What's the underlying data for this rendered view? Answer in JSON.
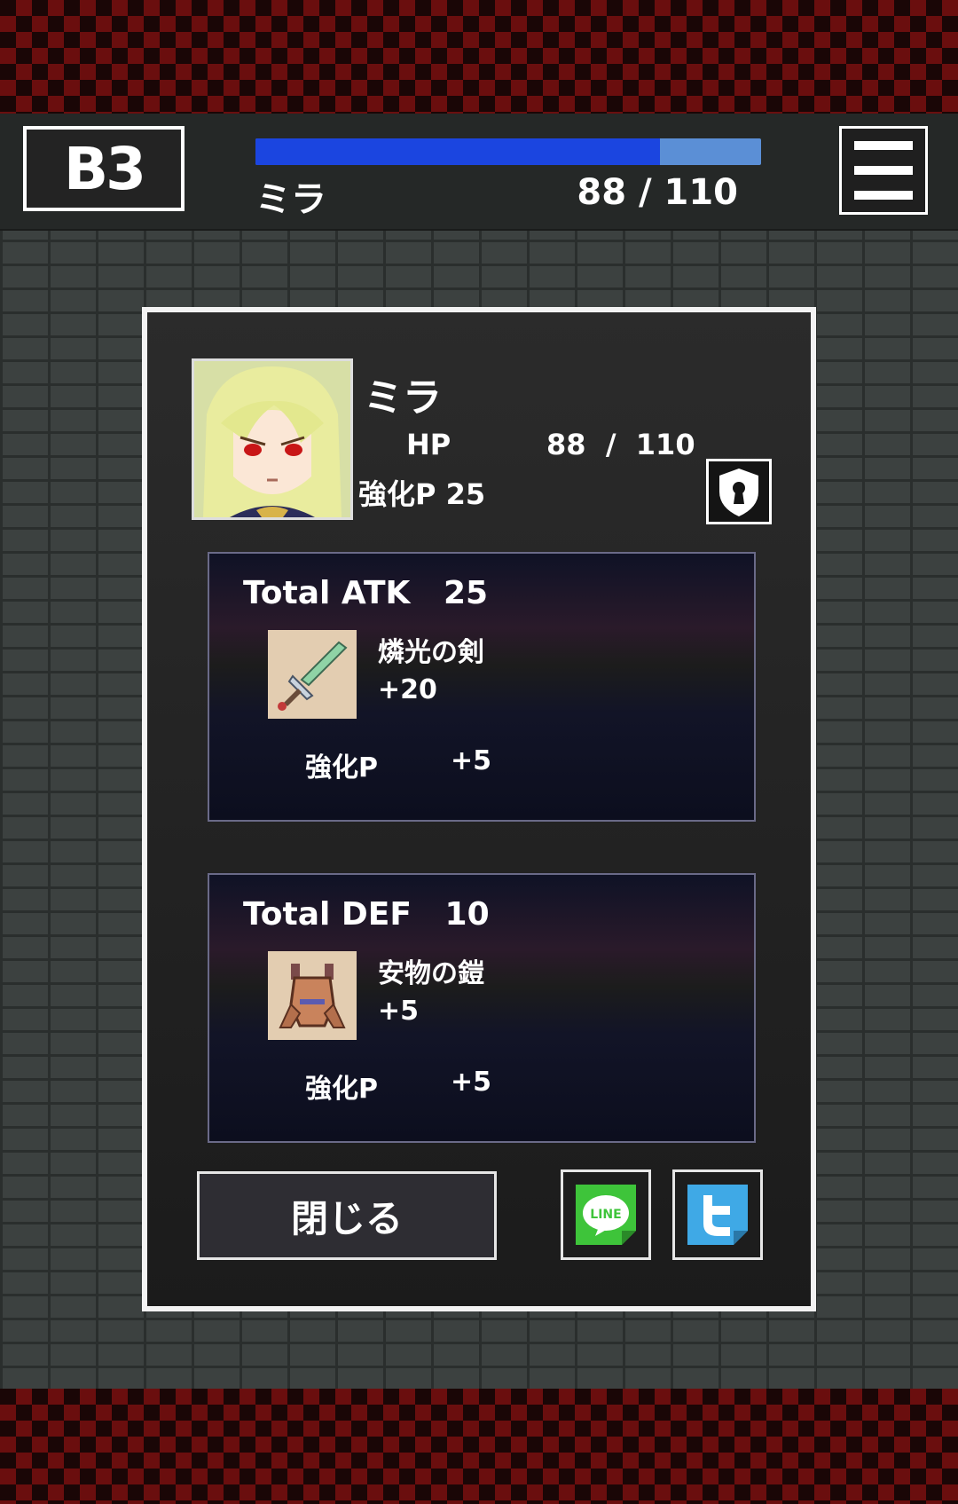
{
  "header": {
    "floor": "B3",
    "name": "ミラ",
    "hp_text": "88 / 110",
    "hp_fraction": 0.8
  },
  "menu": {
    "icon": "hamburger-menu-icon"
  },
  "status": {
    "name": "ミラ",
    "hp_label": "HP",
    "hp_value": "88  /  110",
    "enhance_points": "強化P 25",
    "lock_icon": "shield-keyhole-icon"
  },
  "atk": {
    "title": "Total ATK   25",
    "item_name": "燐光の剣",
    "item_bonus": "+20",
    "pts_label": "強化P",
    "pts_value": "+5",
    "icon": "sword-icon"
  },
  "def": {
    "title": "Total DEF   10",
    "item_name": "安物の鎧",
    "item_bonus": "+5",
    "pts_label": "強化P",
    "pts_value": "+5",
    "icon": "armor-icon"
  },
  "buttons": {
    "close": "閉じる",
    "line_label": "LINE",
    "line_icon": "line-share-icon",
    "twitter_icon": "twitter-share-icon"
  },
  "colors": {
    "hp_fill": "#1b45e0",
    "hp_empty": "#5b8fd6",
    "line_green": "#3ec43a",
    "twitter_blue": "#3fa9e6"
  }
}
